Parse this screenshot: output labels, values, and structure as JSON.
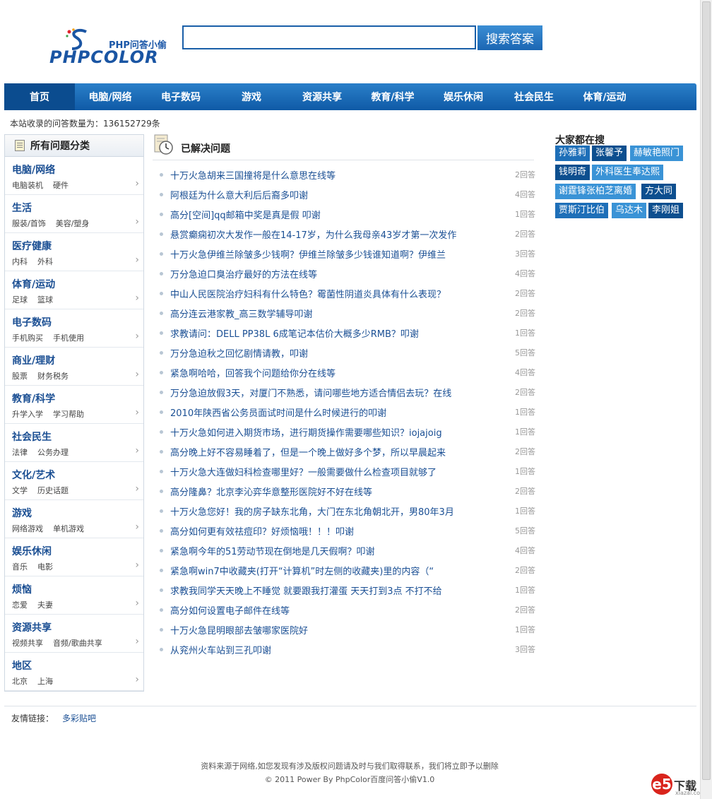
{
  "header": {
    "logo_sub": "PHP问答小偷",
    "logo_main": "PHPCOLOR",
    "search_placeholder": "",
    "search_button": "搜索答案"
  },
  "nav": [
    "首页",
    "电脑/网络",
    "电子数码",
    "游戏",
    "资源共享",
    "教育/科学",
    "娱乐休闲",
    "社会民生",
    "体育/运动"
  ],
  "stat": "本站收录的问答数量为：136152729条",
  "sidebar": {
    "title": "所有问题分类",
    "categories": [
      {
        "title": "电脑/网络",
        "subs": [
          "电脑装机",
          "硬件"
        ]
      },
      {
        "title": "生活",
        "subs": [
          "服装/首饰",
          "美容/塑身"
        ]
      },
      {
        "title": "医疗健康",
        "subs": [
          "内科",
          "外科"
        ]
      },
      {
        "title": "体育/运动",
        "subs": [
          "足球",
          "篮球"
        ]
      },
      {
        "title": "电子数码",
        "subs": [
          "手机购买",
          "手机使用"
        ]
      },
      {
        "title": "商业/理财",
        "subs": [
          "股票",
          "财务税务"
        ]
      },
      {
        "title": "教育/科学",
        "subs": [
          "升学入学",
          "学习帮助"
        ]
      },
      {
        "title": "社会民生",
        "subs": [
          "法律",
          "公务办理"
        ]
      },
      {
        "title": "文化/艺术",
        "subs": [
          "文学",
          "历史话题"
        ]
      },
      {
        "title": "游戏",
        "subs": [
          "网络游戏",
          "单机游戏"
        ]
      },
      {
        "title": "娱乐休闲",
        "subs": [
          "音乐",
          "电影"
        ]
      },
      {
        "title": "烦恼",
        "subs": [
          "恋爱",
          "夫妻"
        ]
      },
      {
        "title": "资源共享",
        "subs": [
          "视频共享",
          "音频/歌曲共享"
        ]
      },
      {
        "title": "地区",
        "subs": [
          "北京",
          "上海"
        ]
      }
    ]
  },
  "main": {
    "title": "已解决问题",
    "questions": [
      {
        "q": "十万火急胡来三国撞将是什么意思在线等",
        "c": "2回答"
      },
      {
        "q": "阿根廷为什么意大利后后裔多叩谢",
        "c": "4回答"
      },
      {
        "q": "高分[空间]qq邮箱中奖是真是假 叩谢",
        "c": "1回答"
      },
      {
        "q": "悬赏癫痫初次大发作一般在14-17岁，为什么我母亲43岁才第一次发作",
        "c": "2回答"
      },
      {
        "q": "十万火急伊维兰除皱多少钱啊？伊维兰除皱多少钱谁知道啊？伊维兰",
        "c": "3回答"
      },
      {
        "q": "万分急迫口臭治疗最好的方法在线等",
        "c": "4回答"
      },
      {
        "q": "中山人民医院治疗妇科有什么特色？霉菌性阴道炎具体有什么表现？",
        "c": "2回答"
      },
      {
        "q": "高分连云港家教_高三数学辅导叩谢",
        "c": "2回答"
      },
      {
        "q": "求教请问：DELL PP38L 6成笔记本估价大概多少RMB？叩谢",
        "c": "1回答"
      },
      {
        "q": "万分急迫秋之回忆剧情请教，叩谢",
        "c": "5回答"
      },
      {
        "q": "紧急啊哈哈，回答我个问题给你分在线等",
        "c": "4回答"
      },
      {
        "q": "万分急迫放假3天，对厦门不熟悉，请问哪些地方适合情侣去玩？在线",
        "c": "2回答"
      },
      {
        "q": "2010年陕西省公务员面试时间是什么时候进行的叩谢",
        "c": "1回答"
      },
      {
        "q": "十万火急如何进入期货市场，进行期货操作需要哪些知识？iojajoig",
        "c": "1回答"
      },
      {
        "q": "高分晚上好不容易睡着了，但是一个晚上做好多个梦，所以早晨起来",
        "c": "2回答"
      },
      {
        "q": "十万火急大连做妇科检查哪里好？一般需要做什么检查项目就够了",
        "c": "1回答"
      },
      {
        "q": "高分隆鼻？北京李沁弈华意整形医院好不好在线等",
        "c": "2回答"
      },
      {
        "q": "十万火急您好！我的房子缺东北角，大门在东北角朝北开，男80年3月",
        "c": "1回答"
      },
      {
        "q": "高分如何更有效祛痘印？好烦恼哦！！！叩谢",
        "c": "5回答"
      },
      {
        "q": "紧急啊今年的51劳动节现在倒地是几天假啊？叩谢",
        "c": "4回答"
      },
      {
        "q": "紧急啊win7中收藏夹(打开“计算机”时左侧的收藏夹)里的内容（“",
        "c": "2回答"
      },
      {
        "q": "求教我同学天天晚上不睡觉 就要跟我打灌蛋 天天打到3点 不打不给",
        "c": "1回答"
      },
      {
        "q": "高分如何设置电子邮件在线等",
        "c": "2回答"
      },
      {
        "q": "十万火急昆明眼部去皱哪家医院好",
        "c": "1回答"
      },
      {
        "q": "从兖州火车站到三孔叩谢",
        "c": "3回答"
      }
    ]
  },
  "hot": {
    "title": "大家都在搜",
    "tags": [
      {
        "t": "孙雅莉",
        "color": "#1e6fb8"
      },
      {
        "t": "张馨予",
        "color": "#0d4f8f"
      },
      {
        "t": "赫敏艳照门",
        "color": "#3a93d6"
      },
      {
        "t": "钱明奇",
        "color": "#0d4f8f"
      },
      {
        "t": "外科医生奉达熙",
        "color": "#3a93d6"
      },
      {
        "t": "谢霆锋张柏芝离婚",
        "color": "#3a93d6"
      },
      {
        "t": "方大同",
        "color": "#0d4f8f"
      },
      {
        "t": "贾斯汀比伯",
        "color": "#1e6fb8"
      },
      {
        "t": "乌达木",
        "color": "#3a93d6"
      },
      {
        "t": "李刚姐",
        "color": "#0d4f8f"
      }
    ]
  },
  "footer": {
    "links_label": "友情链接：",
    "links": [
      "多彩贴吧"
    ],
    "notice": "资料来源于网络,如您发现有涉及版权问题请及时与我们取得联系，我们将立即予以删除",
    "copyright": "© 2011 Power By PhpColor百度问答小偷V1.0",
    "badge_e": "e5",
    "badge_word": "下载",
    "badge_url": "xiazai.com"
  }
}
